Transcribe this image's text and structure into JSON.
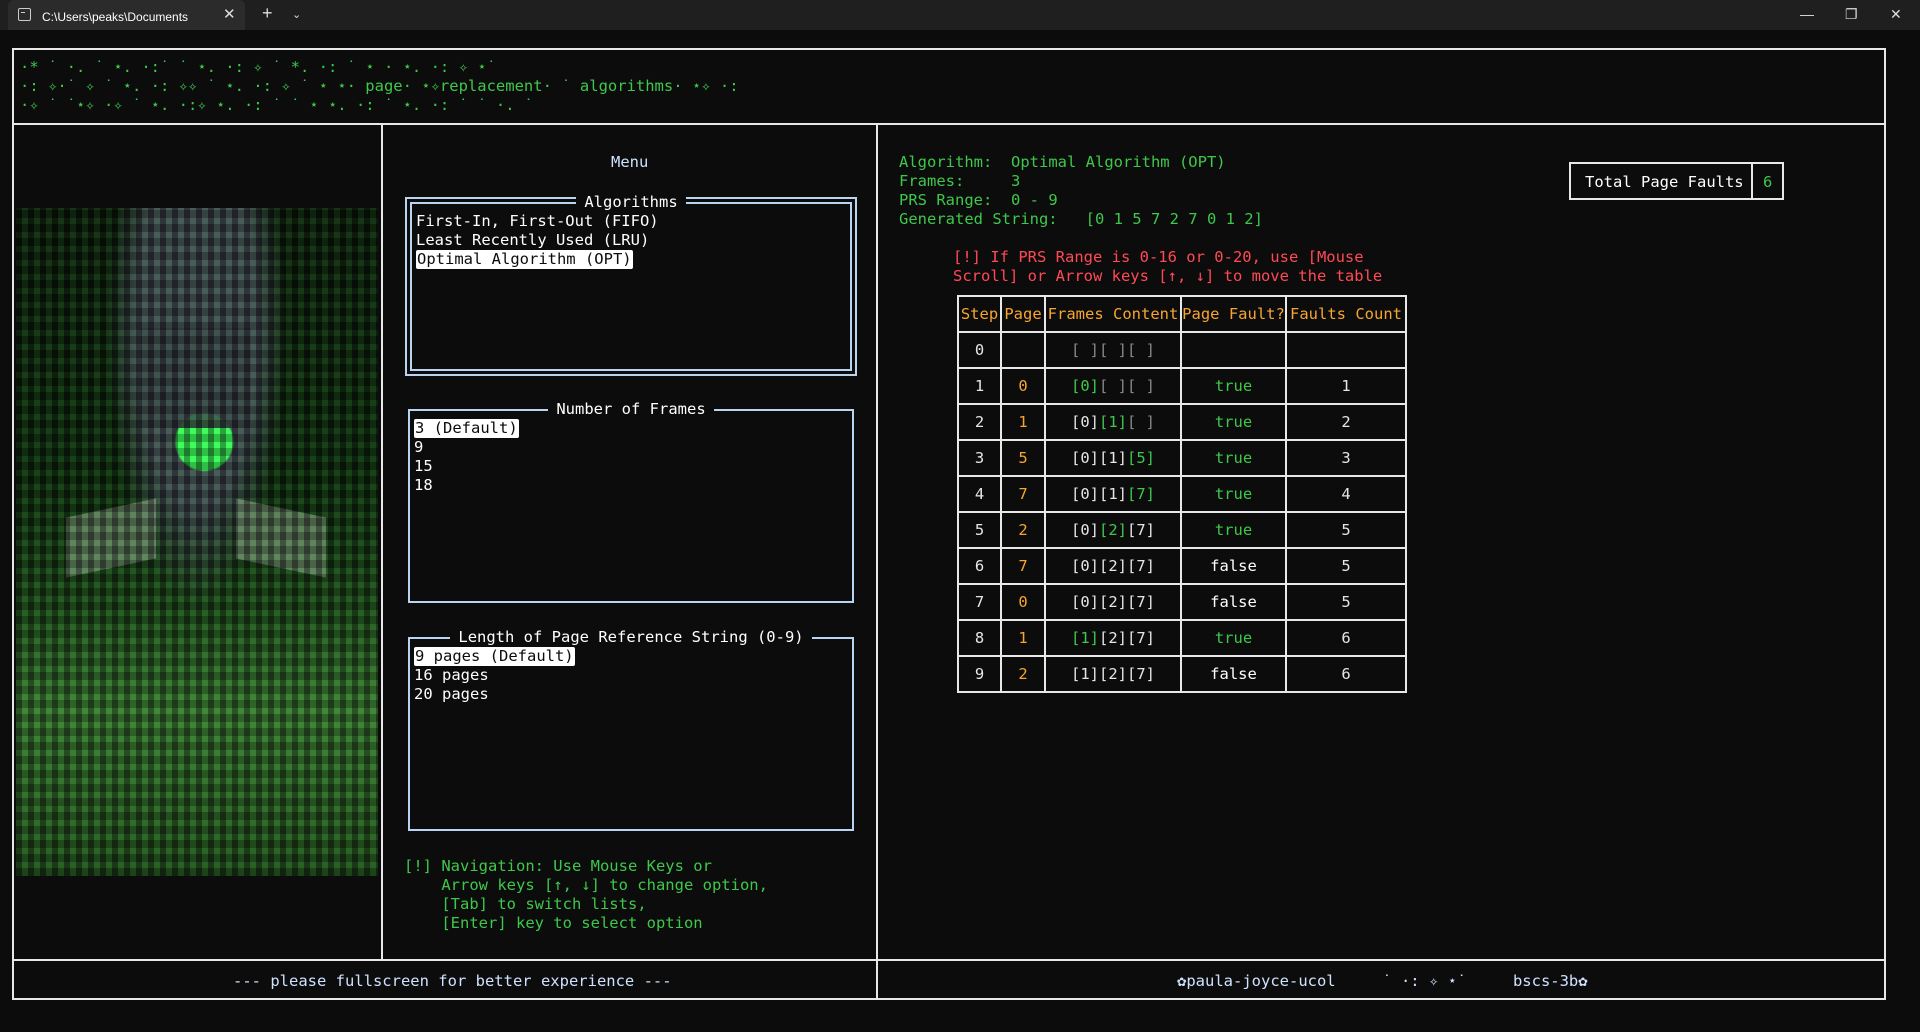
{
  "window": {
    "tab_title": "C:\\Users\\peaks\\Documents",
    "tab_close": "✕",
    "new_tab": "+",
    "tab_dropdown": "⌄",
    "minimize": "—",
    "maximize": "❐",
    "close": "✕"
  },
  "banner": {
    "line1": "·* ˙ ·. ˙ ⋆. ·:˙ ˙ ⋆. ·: ✧ ˙ *. ·: ˙ ⋆ · ⋆. ·: ✧ ⋆˙",
    "line2": "·: ✧·˙ ✧ ˙ ⋆. ·: ✧✧ ˙ ⋆. ·: ✧ ˙ ⋆ ⋆· page· ⋆✧replacement· ˙ algorithms· ⋆✧ ·:",
    "line3": "·✧ ˙ ˙⋆✧ ·✧ ˙ ⋆. ·:✧ ⋆. ·: ˙ ˙ ⋆ ⋆. ·: ˙ ⋆. ·: ˙ ˙ ·. ˙"
  },
  "menu": {
    "title": "Menu",
    "algorithms": {
      "title": "Algorithms",
      "options": [
        "First-In, First-Out (FIFO)",
        "Least Recently Used (LRU)",
        "Optimal Algorithm (OPT)"
      ],
      "selected": "Optimal Algorithm (OPT)"
    },
    "frames": {
      "title": "Number of Frames",
      "options": [
        "3 (Default)",
        "9",
        "15",
        "18"
      ],
      "selected": "3 (Default)"
    },
    "prs_length": {
      "title": "Length of Page Reference String (0-9)",
      "options": [
        "9 pages (Default)",
        "16 pages",
        "20 pages"
      ],
      "selected": "9 pages (Default)"
    },
    "navigation_hint": [
      "[!] Navigation: Use Mouse Keys or",
      "    Arrow keys [↑, ↓] to change option,",
      "    [Tab] to switch lists,",
      "    [Enter] key to select option"
    ]
  },
  "info": {
    "algorithm_label": "Algorithm:",
    "algorithm_value": "Optimal Algorithm (OPT)",
    "frames_label": "Frames:",
    "frames_value": "3",
    "prs_label": "PRS Range:",
    "prs_value": "0 - 9",
    "generated_label": "Generated String:",
    "generated_value": "[0 1 5 7 2 7 0 1 2]",
    "warning_line1": "[!] If PRS Range is 0-16 or 0-20, use [Mouse",
    "warning_line2": "Scroll] or Arrow keys [↑, ↓] to move the table"
  },
  "total_page_faults": {
    "label": "Total Page Faults",
    "value": "6"
  },
  "table": {
    "headers": [
      "Step",
      "Page",
      "Frames Content",
      "Page Fault?",
      "Faults Count"
    ],
    "rows": [
      {
        "step": "0",
        "page": "",
        "frames": [
          "[ ]",
          "[ ]",
          "[ ]"
        ],
        "new_index": -1,
        "fault": "",
        "count": ""
      },
      {
        "step": "1",
        "page": "0",
        "frames": [
          "[0]",
          "[ ]",
          "[ ]"
        ],
        "new_index": 0,
        "fault": "true",
        "count": "1"
      },
      {
        "step": "2",
        "page": "1",
        "frames": [
          "[0]",
          "[1]",
          "[ ]"
        ],
        "new_index": 1,
        "fault": "true",
        "count": "2"
      },
      {
        "step": "3",
        "page": "5",
        "frames": [
          "[0]",
          "[1]",
          "[5]"
        ],
        "new_index": 2,
        "fault": "true",
        "count": "3"
      },
      {
        "step": "4",
        "page": "7",
        "frames": [
          "[0]",
          "[1]",
          "[7]"
        ],
        "new_index": 2,
        "fault": "true",
        "count": "4"
      },
      {
        "step": "5",
        "page": "2",
        "frames": [
          "[0]",
          "[2]",
          "[7]"
        ],
        "new_index": 1,
        "fault": "true",
        "count": "5"
      },
      {
        "step": "6",
        "page": "7",
        "frames": [
          "[0]",
          "[2]",
          "[7]"
        ],
        "new_index": -1,
        "fault": "false",
        "count": "5"
      },
      {
        "step": "7",
        "page": "0",
        "frames": [
          "[0]",
          "[2]",
          "[7]"
        ],
        "new_index": -1,
        "fault": "false",
        "count": "5"
      },
      {
        "step": "8",
        "page": "1",
        "frames": [
          "[1]",
          "[2]",
          "[7]"
        ],
        "new_index": 0,
        "fault": "true",
        "count": "6"
      },
      {
        "step": "9",
        "page": "2",
        "frames": [
          "[1]",
          "[2]",
          "[7]"
        ],
        "new_index": -1,
        "fault": "false",
        "count": "6"
      }
    ]
  },
  "footer": {
    "left": "--- please fullscreen for better experience ---",
    "right": "✿paula-joyce-ucol     ˙ ·: ✧ ⋆˙     bscs-3b✿"
  },
  "colors": {
    "green": "#3ec84b",
    "orange": "#f7a531",
    "red": "#ff4a55",
    "border": "#e8e8e8",
    "background": "#0c0c0c"
  }
}
